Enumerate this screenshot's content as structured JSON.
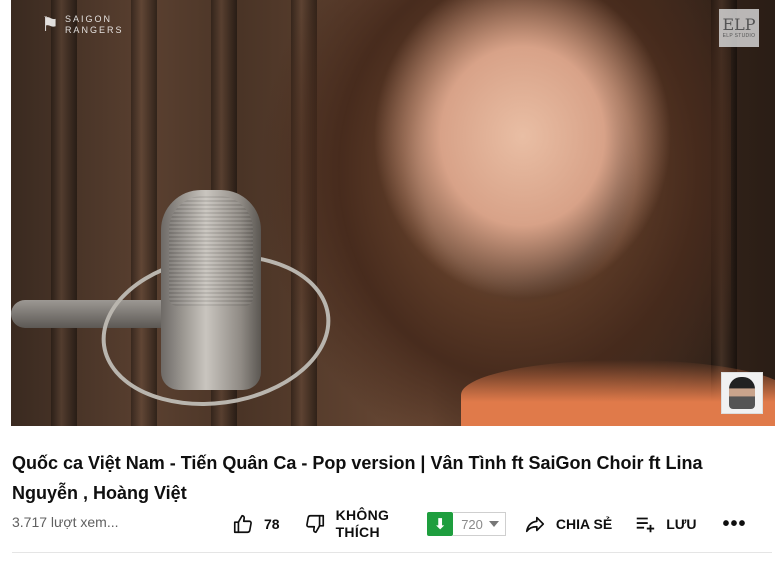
{
  "video": {
    "watermark_left": {
      "line1": "SAIGON",
      "line2": "RANGERS"
    },
    "watermark_right": {
      "mark": "ELP",
      "label": "ELP STUDIO"
    }
  },
  "title": "Quốc ca Việt Nam - Tiến Quân Ca - Pop version | Vân Tình ft SaiGon Choir ft Lina Nguyễn , Hoàng Việt",
  "views": "3.717 lượt xem...",
  "actions": {
    "like_count": "78",
    "dislike_label_1": "KHÔNG",
    "dislike_label_2": "THÍCH",
    "download_quality": "720",
    "share_label": "CHIA SẺ",
    "save_label": "LƯU",
    "more_label": "•••"
  },
  "colors": {
    "download_green": "#1e9e3e",
    "text_primary": "#0f0f0f",
    "text_secondary": "#606060"
  },
  "icons": [
    "thumbs-up-icon",
    "thumbs-down-icon",
    "download-arrow-icon",
    "caret-down-icon",
    "share-icon",
    "playlist-add-icon",
    "more-icon"
  ]
}
